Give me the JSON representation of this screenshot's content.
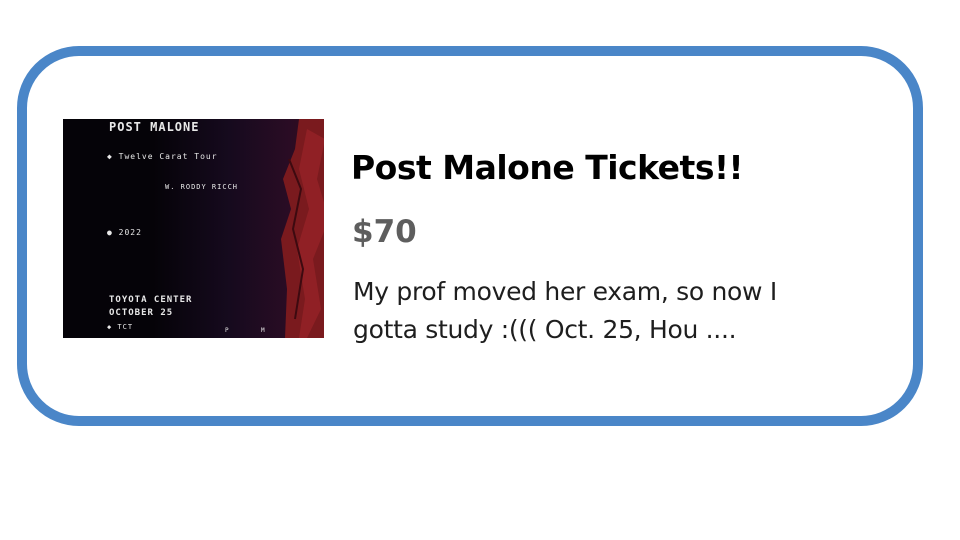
{
  "listing": {
    "title": "Post Malone Tickets!!",
    "price": "$70",
    "description_line1": "My prof moved her exam, so now I",
    "description_line2": "gotta study :((( Oct. 25, Hou ...."
  },
  "poster": {
    "artist": "POST MALONE",
    "tour": "◆ Twelve Carat Tour",
    "feat": "W. RODDY RICCH",
    "year": "● 2022",
    "venue": "TOYOTA CENTER",
    "date": "OCTOBER 25",
    "code": "◆ TCT",
    "mark1": "P",
    "mark2": "M"
  },
  "colors": {
    "card_border": "#4a86c8",
    "price_text": "#5e5e5e",
    "poster_bg": "#050308",
    "poster_figure": "#7a1a1e"
  }
}
